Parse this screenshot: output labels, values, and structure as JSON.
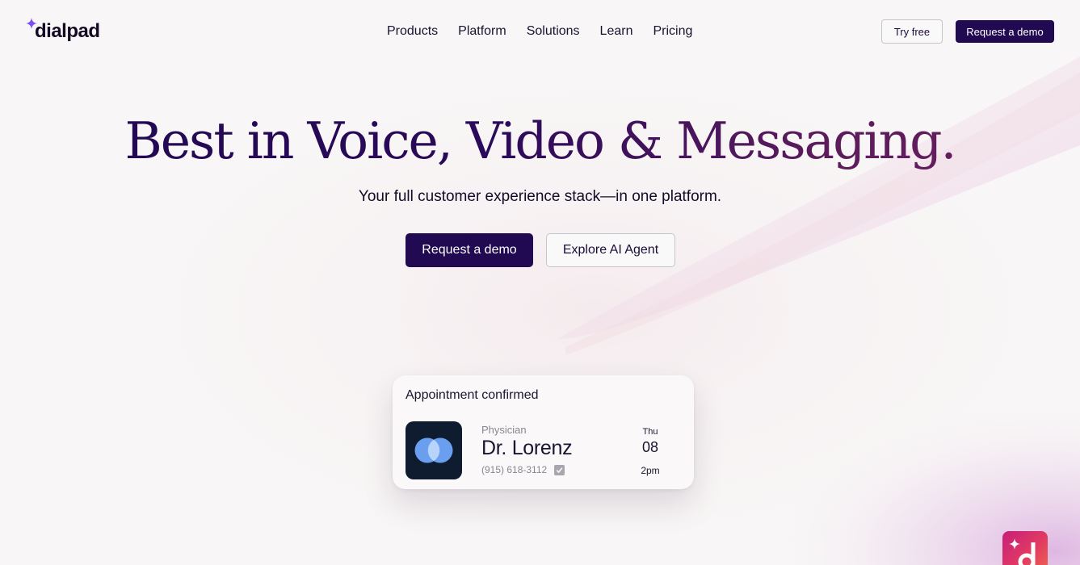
{
  "brand": {
    "name": "dialpad"
  },
  "nav": {
    "items": [
      {
        "label": "Products"
      },
      {
        "label": "Platform"
      },
      {
        "label": "Solutions"
      },
      {
        "label": "Learn"
      },
      {
        "label": "Pricing"
      }
    ],
    "try_free_label": "Try free",
    "request_demo_label": "Request a demo"
  },
  "hero": {
    "title": "Best in Voice, Video & Messaging.",
    "subtitle": "Your full customer experience stack—in one platform.",
    "primary_cta": "Request a demo",
    "secondary_cta": "Explore AI Agent"
  },
  "appointment_card": {
    "title": "Appointment confirmed",
    "role": "Physician",
    "name": "Dr. Lorenz",
    "phone": "(915) 618-3112",
    "day": "Thu",
    "date": "08",
    "time": "2pm"
  },
  "colors": {
    "primary": "#210a52",
    "accent_spark": "#7b4ff0",
    "hero_gradient_end": "#6a1f5c",
    "badge_gradient": "#e23a63"
  },
  "icons": {
    "logo_spark": "sparkle-icon",
    "card_icon": "overlapping-circles-icon",
    "verified": "checkmark-icon",
    "corner_badge": "dialpad-ai-badge-icon"
  }
}
